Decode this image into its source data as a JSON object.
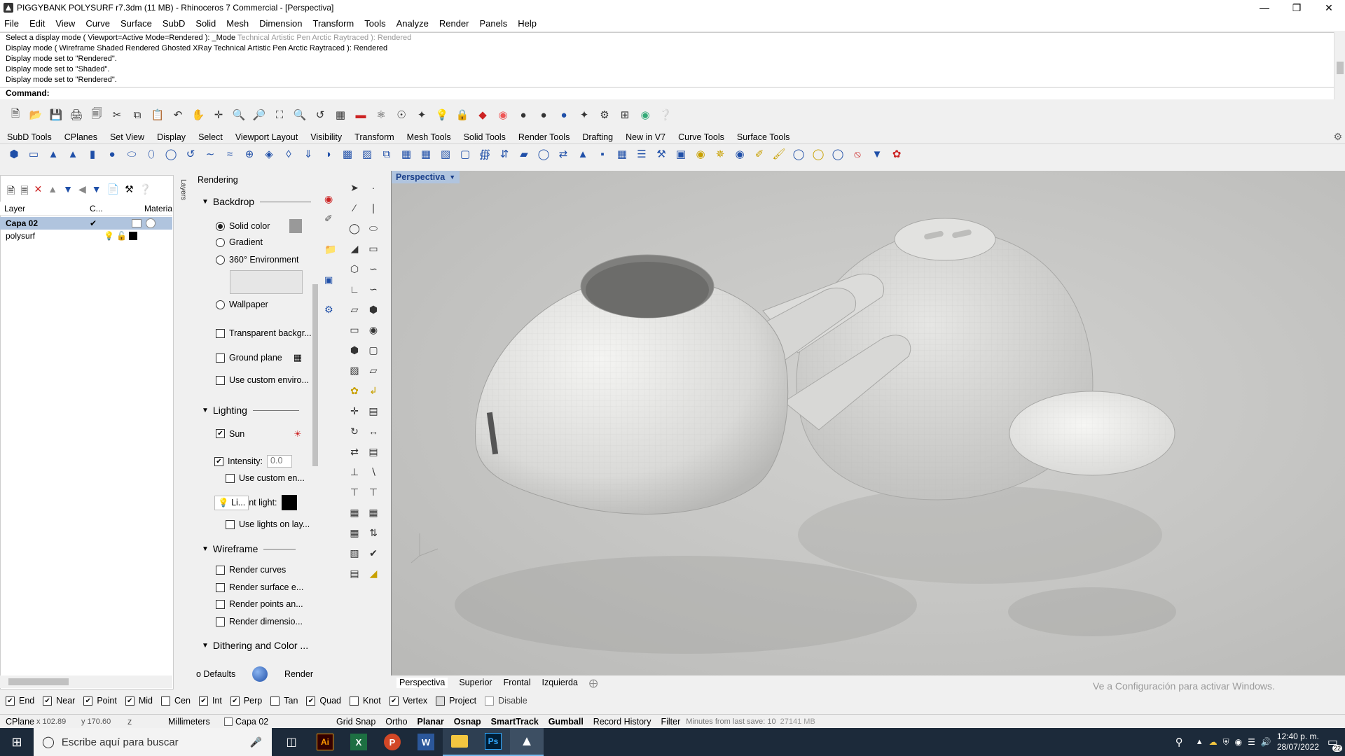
{
  "window": {
    "title": "PIGGYBANK POLYSURF r7.3dm (11 MB) - Rhinoceros 7 Commercial - [Perspectiva]"
  },
  "menu": [
    "File",
    "Edit",
    "View",
    "Curve",
    "Surface",
    "SubD",
    "Solid",
    "Mesh",
    "Dimension",
    "Transform",
    "Tools",
    "Analyze",
    "Render",
    "Panels",
    "Help"
  ],
  "command_history": [
    {
      "text": "Select a display mode ( Viewport=Active  Mode=Rendered ):  _Mode",
      "ghost": "Technical  Artistic  Pen  Arctic  Raytraced ): Rendered"
    },
    {
      "text": "Display mode ( Wireframe  Shaded  Rendered  Ghosted  XRay  Technical  Artistic  Pen  Arctic  Raytraced ): Rendered",
      "ghost": ""
    },
    {
      "text": "Display mode set to \"Rendered\".",
      "ghost": ""
    },
    {
      "text": "Display mode set to \"Shaded\".",
      "ghost": ""
    },
    {
      "text": "Display mode set to \"Rendered\".",
      "ghost": ""
    }
  ],
  "command_label": "Command:",
  "toolbar_tabs": [
    "SubD Tools",
    "CPlanes",
    "Set View",
    "Display",
    "Select",
    "Viewport Layout",
    "Visibility",
    "Transform",
    "Mesh Tools",
    "Solid Tools",
    "Render Tools",
    "Drafting",
    "New in V7",
    "Curve Tools",
    "Surface Tools"
  ],
  "layers": {
    "headers": {
      "layer": "Layer",
      "current": "C...",
      "material": "Materia"
    },
    "rows": [
      {
        "name": "Capa 02",
        "selected": true,
        "swatch": "#ffffff"
      },
      {
        "name": "polysurf",
        "selected": false,
        "swatch": "#000000"
      }
    ],
    "side_tab": "Layers"
  },
  "rendering": {
    "title": "Rendering",
    "backdrop": {
      "heading": "Backdrop",
      "solid_color": "Solid color",
      "gradient": "Gradient",
      "environment": "360° Environment",
      "wallpaper": "Wallpaper",
      "transparent": "Transparent backgr...",
      "ground_plane": "Ground plane",
      "custom_env": "Use custom enviro..."
    },
    "lighting": {
      "heading": "Lighting",
      "sun": "Sun",
      "intensity_label": "Intensity:",
      "intensity_value": "0.0",
      "custom_env": "Use custom en...",
      "skylight_prefix": "Li...",
      "skylight_suffix": "nt light:",
      "lights_on_layers": "Use lights on lay..."
    },
    "wireframe": {
      "heading": "Wireframe",
      "render_curves": "Render curves",
      "render_surface": "Render surface e...",
      "render_points": "Render points an...",
      "render_dims": "Render dimensio..."
    },
    "dithering": "Dithering and Color ...",
    "defaults_button": "o Defaults",
    "render_button": "Render"
  },
  "viewport": {
    "active_tab": "Perspectiva",
    "tabs": [
      "Perspectiva",
      "Superior",
      "Frontal",
      "Izquierda"
    ],
    "watermark": "Ve a Configuración para activar Windows."
  },
  "osnap": [
    {
      "label": "End",
      "checked": true
    },
    {
      "label": "Near",
      "checked": true
    },
    {
      "label": "Point",
      "checked": true
    },
    {
      "label": "Mid",
      "checked": true
    },
    {
      "label": "Cen",
      "checked": false
    },
    {
      "label": "Int",
      "checked": true
    },
    {
      "label": "Perp",
      "checked": true
    },
    {
      "label": "Tan",
      "checked": false
    },
    {
      "label": "Quad",
      "checked": true
    },
    {
      "label": "Knot",
      "checked": false
    },
    {
      "label": "Vertex",
      "checked": true
    },
    {
      "label": "Project",
      "checked": false
    },
    {
      "label": "Disable",
      "checked": false
    }
  ],
  "status": {
    "cplane": "CPlane",
    "x": "x 102.89",
    "y": "y 170.60",
    "z": "z",
    "units": "Millimeters",
    "layer": "Capa 02",
    "toggles": [
      "Grid Snap",
      "Ortho",
      "Planar",
      "Osnap",
      "SmartTrack",
      "Gumball",
      "Record History",
      "Filter"
    ],
    "last_save": "Minutes from last save: 10",
    "memory": "27141 MB"
  },
  "taskbar": {
    "search_placeholder": "Escribe aquí para buscar",
    "time": "12:40 p. m.",
    "date": "28/07/2022",
    "notification_count": "22"
  },
  "colors": {
    "viewport_bg": "#c8c8c6",
    "active_tab": "#b0c4de",
    "layer_selected": "#b0c4de",
    "taskbar": "#1c2a3a"
  }
}
